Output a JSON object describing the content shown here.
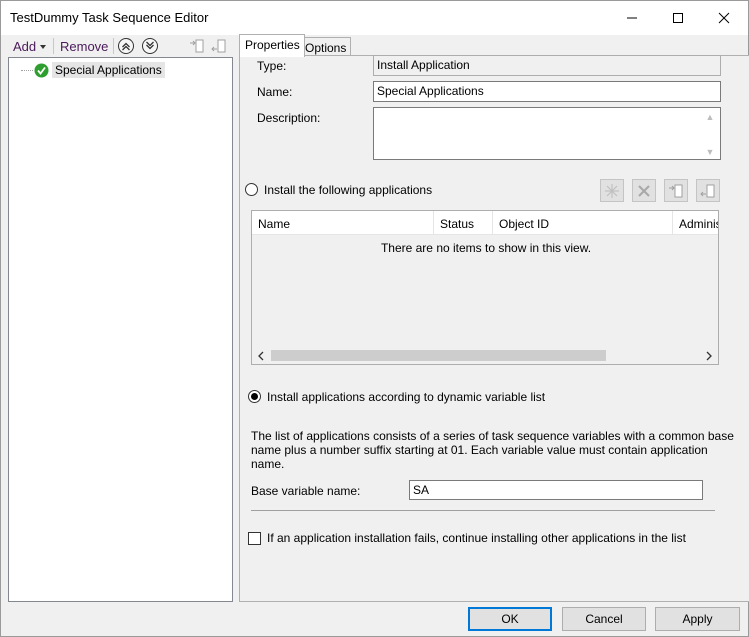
{
  "window": {
    "title": "TestDummy Task Sequence Editor",
    "controls": {
      "minimize_icon": "minimize-icon",
      "maximize_icon": "maximize-icon",
      "close_icon": "close-icon"
    }
  },
  "toolbar": {
    "add_label": "Add",
    "remove_label": "Remove",
    "icons": [
      "move-up-icon",
      "move-down-icon",
      "indent-icon",
      "outdent-icon"
    ]
  },
  "tree": {
    "items": [
      {
        "label": "Special Applications",
        "icon": "check-circle-icon"
      }
    ]
  },
  "tabs": [
    {
      "label": "Properties",
      "active": true
    },
    {
      "label": "Options",
      "active": false
    }
  ],
  "properties": {
    "type_label": "Type:",
    "type_value": "Install Application",
    "name_label": "Name:",
    "name_value": "Special Applications",
    "description_label": "Description:",
    "description_value": "",
    "radio_install_following": "Install the following applications",
    "list": {
      "columns": [
        "Name",
        "Status",
        "Object ID",
        "Administ"
      ],
      "empty_text": "There are no items to show in this view.",
      "action_icons": [
        "star-icon",
        "delete-icon",
        "move-up-icon",
        "move-down-icon"
      ]
    },
    "radio_dynamic": "Install applications according to dynamic variable list",
    "dynamic_selected": true,
    "description_text": "The list of applications consists of a series of task sequence variables with a common base name plus a number suffix starting at 01. Each variable value must contain application name.",
    "base_variable_label": "Base variable name:",
    "base_variable_value": "SA",
    "continue_on_fail_label": "If an application installation fails, continue installing other applications in the list",
    "continue_on_fail_checked": false
  },
  "buttons": {
    "ok": "OK",
    "cancel": "Cancel",
    "apply": "Apply"
  },
  "colors": {
    "accent": "#0078d7",
    "toolbar_text": "#4a1a5a",
    "check_green": "#2e9e2e"
  }
}
